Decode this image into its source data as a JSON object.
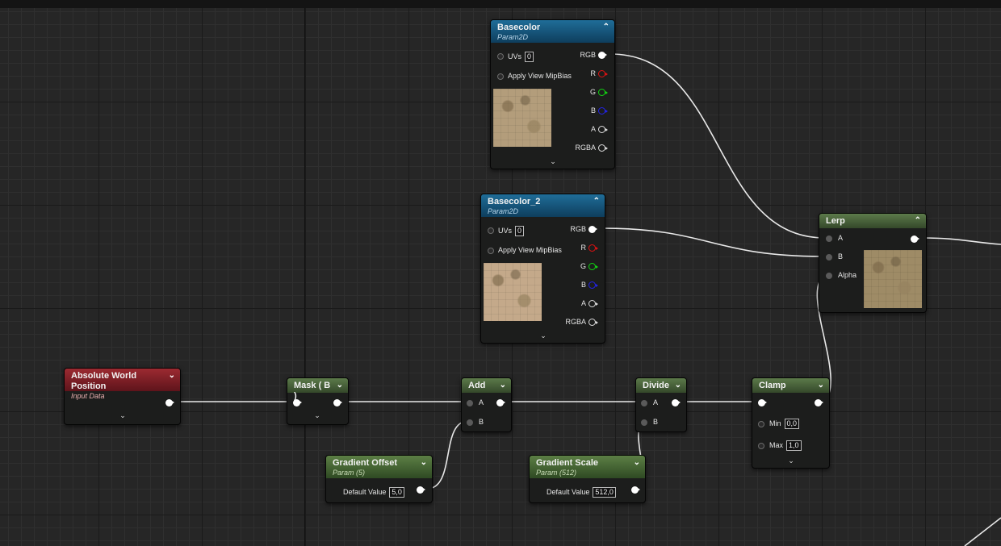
{
  "colors": {
    "graph_bg": "#262626",
    "param_header": "#1f6d98",
    "green_header": "#5c7f45",
    "input_header": "#9c2a31"
  },
  "icons": {
    "collapse": "chevron-up-icon",
    "expand": "chevron-down-icon",
    "output_pin": "exec-pin-icon"
  },
  "nodes": {
    "basecolor": {
      "title": "Basecolor",
      "subtitle": "Param2D",
      "uvs_label": "UVs",
      "uvs_value": "0",
      "mip_label": "Apply View MipBias",
      "outputs": [
        "RGB",
        "R",
        "G",
        "B",
        "A",
        "RGBA"
      ]
    },
    "basecolor2": {
      "title": "Basecolor_2",
      "subtitle": "Param2D",
      "uvs_label": "UVs",
      "uvs_value": "0",
      "mip_label": "Apply View MipBias",
      "outputs": [
        "RGB",
        "R",
        "G",
        "B",
        "A",
        "RGBA"
      ]
    },
    "lerp": {
      "title": "Lerp",
      "inputs": [
        "A",
        "B",
        "Alpha"
      ]
    },
    "abs_world": {
      "title": "Absolute World Position",
      "subtitle": "Input Data"
    },
    "mask": {
      "title": "Mask ( B )"
    },
    "add": {
      "title": "Add",
      "inputs": [
        "A",
        "B"
      ]
    },
    "divide": {
      "title": "Divide",
      "inputs": [
        "A",
        "B"
      ]
    },
    "clamp": {
      "title": "Clamp",
      "min_label": "Min",
      "min_value": "0,0",
      "max_label": "Max",
      "max_value": "1,0"
    },
    "gradient_offset": {
      "title": "Gradient Offset",
      "subtitle": "Param (5)",
      "default_label": "Default Value",
      "default_value": "5,0"
    },
    "gradient_scale": {
      "title": "Gradient Scale",
      "subtitle": "Param (512)",
      "default_label": "Default Value",
      "default_value": "512,0"
    }
  }
}
